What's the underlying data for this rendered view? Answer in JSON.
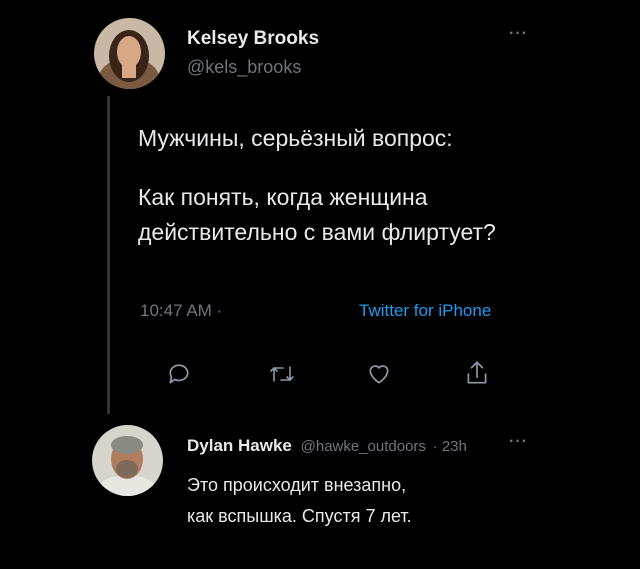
{
  "main_tweet": {
    "author_name": "Kelsey Brooks",
    "author_handle": "@kels_brooks",
    "more_label": "···",
    "text_line1": "Мужчины, серьёзный вопрос:",
    "text_line2": "Как понять, когда женщина",
    "text_line3": "действительно с вами флиртует?",
    "time": "10:47 AM ·",
    "source": "Twitter for iPhone"
  },
  "actions": [
    "reply-icon",
    "retweet-icon",
    "like-icon",
    "share-icon"
  ],
  "reply": {
    "author_name": "Dylan Hawke",
    "author_handle": "@hawke_outdoors",
    "age": "· 23h",
    "more_label": "···",
    "text_line1": "Это происходит внезапно,",
    "text_line2": "как вспышка. Спустя 7 лет."
  },
  "colors": {
    "background": "#000000",
    "text": "#e7e9ea",
    "muted": "#6e767d",
    "link": "#1d9bf0"
  }
}
